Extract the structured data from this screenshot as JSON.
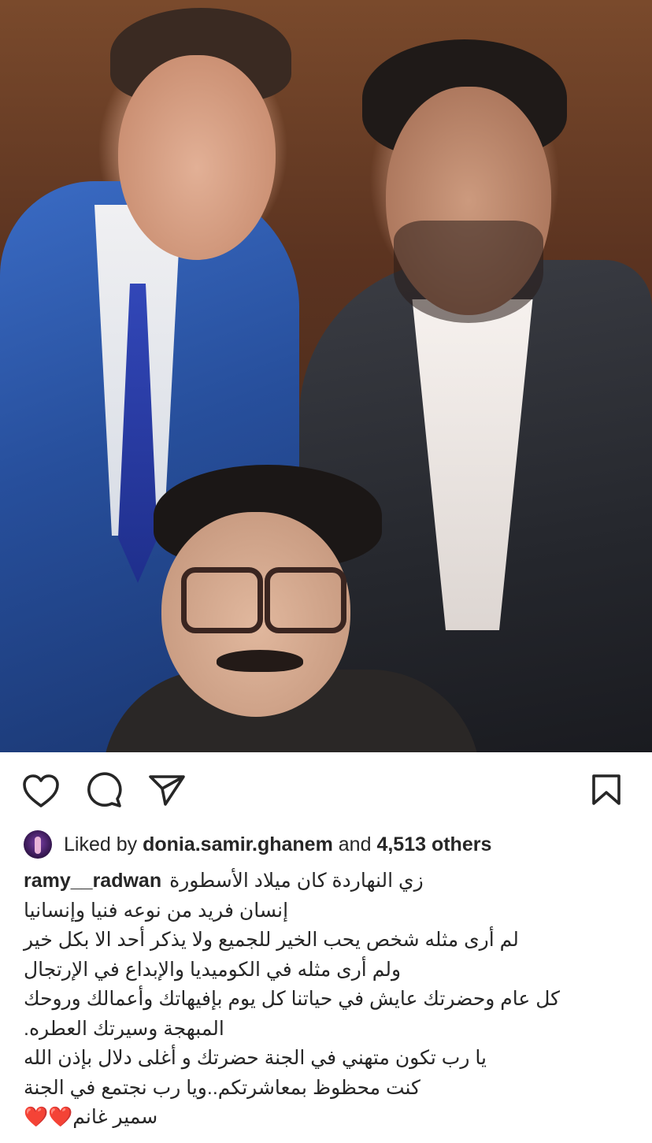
{
  "post": {
    "liked_by_prefix": "Liked by",
    "liked_by_user": "donia.samir.ghanem",
    "liked_and": "and",
    "liked_count": "4,513 others",
    "caption_username": "ramy__radwan",
    "caption_lines": [
      "زي النهاردة كان ميلاد الأسطورة",
      "إنسان فريد من نوعه فنيا وإنسانيا",
      "لم أرى مثله شخص يحب الخير للجميع ولا يذكر أحد الا بكل خير",
      "ولم أرى مثله في الكوميديا والإبداع في الإرتجال",
      "كل عام وحضرتك عايش في حياتنا كل يوم بإفيهاتك وأعمالك وروحك",
      "المبهجة وسيرتك العطره.",
      "يا رب تكون متهني في الجنة حضرتك و أغلى دلال بإذن الله",
      "كنت محظوظ بمعاشرتكم..ويا رب نجتمع في الجنة",
      "سمير غانم❤️❤️"
    ]
  },
  "icons": {
    "like": "heart-icon",
    "comment": "comment-icon",
    "share": "send-icon",
    "save": "bookmark-icon"
  },
  "colors": {
    "text": "#262626",
    "background": "#ffffff"
  }
}
